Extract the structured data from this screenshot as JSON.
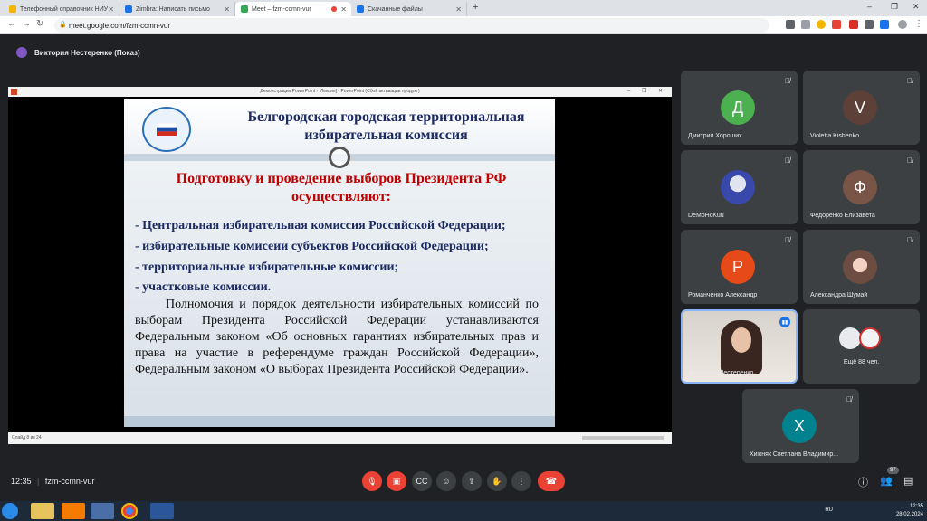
{
  "browser": {
    "tabs": [
      {
        "title": "Телефонный справочник НИУ",
        "color": "#f4b400"
      },
      {
        "title": "Zimbra: Написать письмо",
        "color": "#1a73e8"
      },
      {
        "title": "Meet – fzm-ccmn-vur",
        "color": "#34a853",
        "active": true
      },
      {
        "title": "Скачанные файлы",
        "color": "#1a73e8"
      }
    ],
    "url": "meet.google.com/fzm-ccmn-vur"
  },
  "meet": {
    "presenter": "Виктория Нестеренко (Показ)",
    "ppt_window_title": "Демонстрация PowerPoint - [Лекция] - PowerPoint (Сбой активации продукт)",
    "ppt_status": "Слайд 8 из 24",
    "slide": {
      "title": "Белгородская городская территориальная избирательная комиссия",
      "heading": "Подготовку и проведение выборов Президента РФ осуществляют:",
      "bullets": [
        "- Центральная избирательная комиссия Российской Федерации;",
        "- избирательные комисеии субъектов Российской Федерации;",
        "- территориальные избирательные комиссии;",
        " - участковые комиссии."
      ],
      "paragraph": "Полномочия и порядок деятельности избирательных комиссий по выборам Президента Российской Федерации  устанавливаются Федеральным законом «Об основных гарантиях избирательных прав и права на участие в референдуме граждан Российской Федерации», Федеральным законом «О выборах Президента Российской Федерации»."
    },
    "participants": [
      {
        "name": "Дмитрий Хороших",
        "initial": "Д",
        "color": "#4caf50"
      },
      {
        "name": "Violetta Kishenko",
        "initial": "V",
        "color": "#5d4037"
      },
      {
        "name": "DeMoHcKuu",
        "initial": "",
        "color": "#3949ab"
      },
      {
        "name": "Федоренко Елизавета",
        "initial": "Ф",
        "color": "#795548"
      },
      {
        "name": "Романченко Александр",
        "initial": "Р",
        "color": "#e64a19"
      },
      {
        "name": "Александра Шумай",
        "initial": "",
        "color": "#6d4c41"
      },
      {
        "name": "Виктория Нестеренко",
        "initial": "",
        "color": "#000000"
      },
      {
        "name": "Хижняк Светлана Владимир...",
        "initial": "Х",
        "color": "#00838f"
      }
    ],
    "more_label": "Ещё 88 чел.",
    "time": "12:35",
    "separator": "|",
    "meeting_code": "fzm-ccmn-vur",
    "participant_count": "97"
  },
  "taskbar": {
    "lang": "RU",
    "clock": "12:35",
    "date": "28.02.2024"
  }
}
